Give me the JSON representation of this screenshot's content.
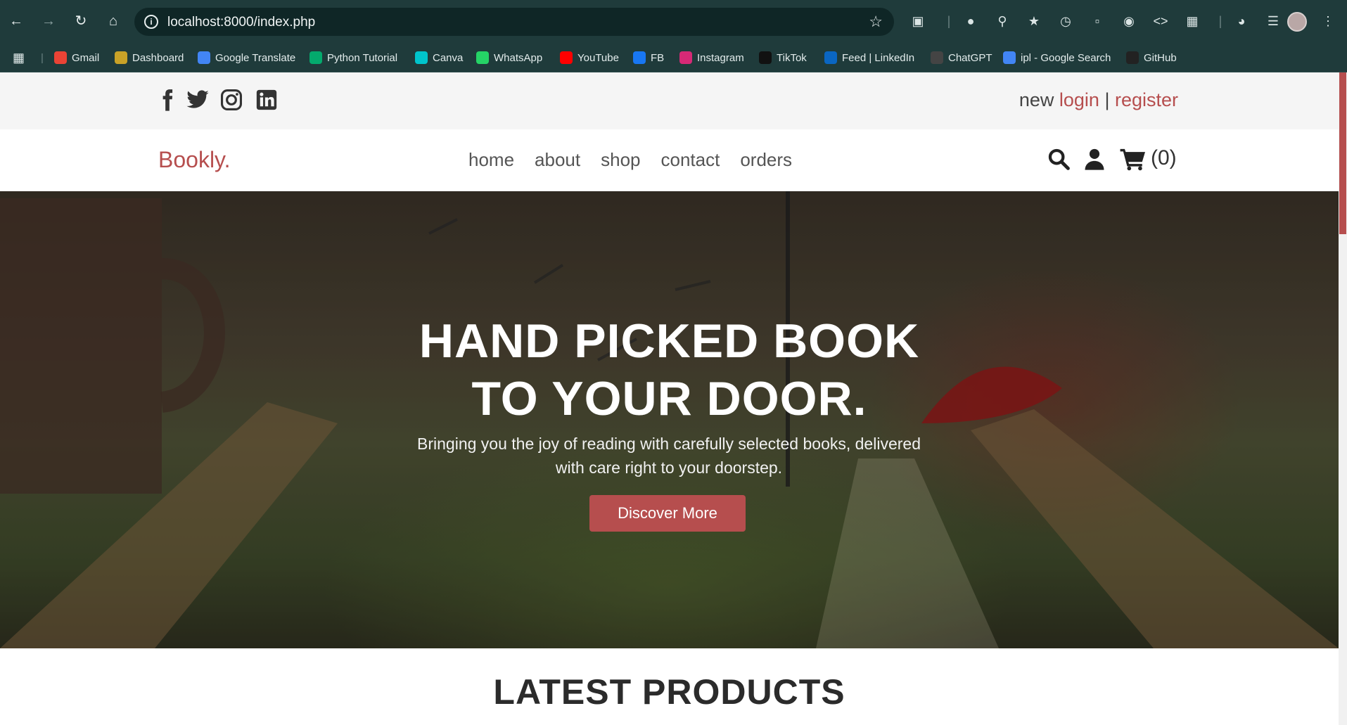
{
  "browser": {
    "url": "localhost:8000/index.php",
    "bookmarks": [
      {
        "label": "Gmail",
        "icon": "gmail-icon",
        "color": "#ea4335"
      },
      {
        "label": "Dashboard",
        "icon": "dashboard-icon",
        "color": "#c9a227"
      },
      {
        "label": "Google Translate",
        "icon": "translate-icon",
        "color": "#4285f4"
      },
      {
        "label": "Python Tutorial",
        "icon": "w3schools-icon",
        "color": "#04aa6d"
      },
      {
        "label": "Canva",
        "icon": "canva-icon",
        "color": "#00c4cc"
      },
      {
        "label": "WhatsApp",
        "icon": "whatsapp-icon",
        "color": "#25d366"
      },
      {
        "label": "YouTube",
        "icon": "youtube-icon",
        "color": "#ff0000"
      },
      {
        "label": "FB",
        "icon": "facebook-icon",
        "color": "#1877f2"
      },
      {
        "label": "Instagram",
        "icon": "instagram-icon",
        "color": "#d62976"
      },
      {
        "label": "TikTok",
        "icon": "tiktok-icon",
        "color": "#111111"
      },
      {
        "label": "Feed | LinkedIn",
        "icon": "linkedin-icon",
        "color": "#0a66c2"
      },
      {
        "label": "ChatGPT",
        "icon": "chatgpt-icon",
        "color": "#444444"
      },
      {
        "label": "ipl - Google Search",
        "icon": "google-icon",
        "color": "#4285f4"
      },
      {
        "label": "GitHub",
        "icon": "github-icon",
        "color": "#222222"
      }
    ]
  },
  "site": {
    "auth": {
      "prefix": "new",
      "login": "login",
      "separator": "|",
      "register": "register"
    },
    "logo": "Bookly.",
    "menu": [
      "home",
      "about",
      "shop",
      "contact",
      "orders"
    ],
    "cart_count": "(0)",
    "hero": {
      "title_line1": "HAND PICKED BOOK",
      "title_line2": "TO YOUR DOOR.",
      "subtitle": "Bringing you the joy of reading with carefully selected books, delivered with care right to your doorstep.",
      "button": "Discover More"
    },
    "latest_heading": "LATEST PRODUCTS"
  },
  "colors": {
    "accent": "#b64e4e",
    "chrome": "#1f3b3b"
  }
}
